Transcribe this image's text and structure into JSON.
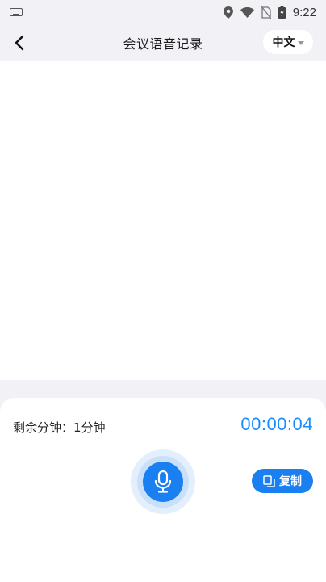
{
  "status_bar": {
    "time": "9:22",
    "icons": [
      "keyboard-icon",
      "location-icon",
      "wifi-icon",
      "no-sim-icon",
      "battery-icon"
    ]
  },
  "nav": {
    "title": "会议语音记录",
    "language": "中文"
  },
  "panel": {
    "remaining_label": "剩余分钟：1分钟",
    "timer": "00:00:04",
    "copy_label": "复制"
  },
  "colors": {
    "accent": "#1a7ff0",
    "timer": "#1a8cff",
    "background": "#f2f2f6"
  }
}
